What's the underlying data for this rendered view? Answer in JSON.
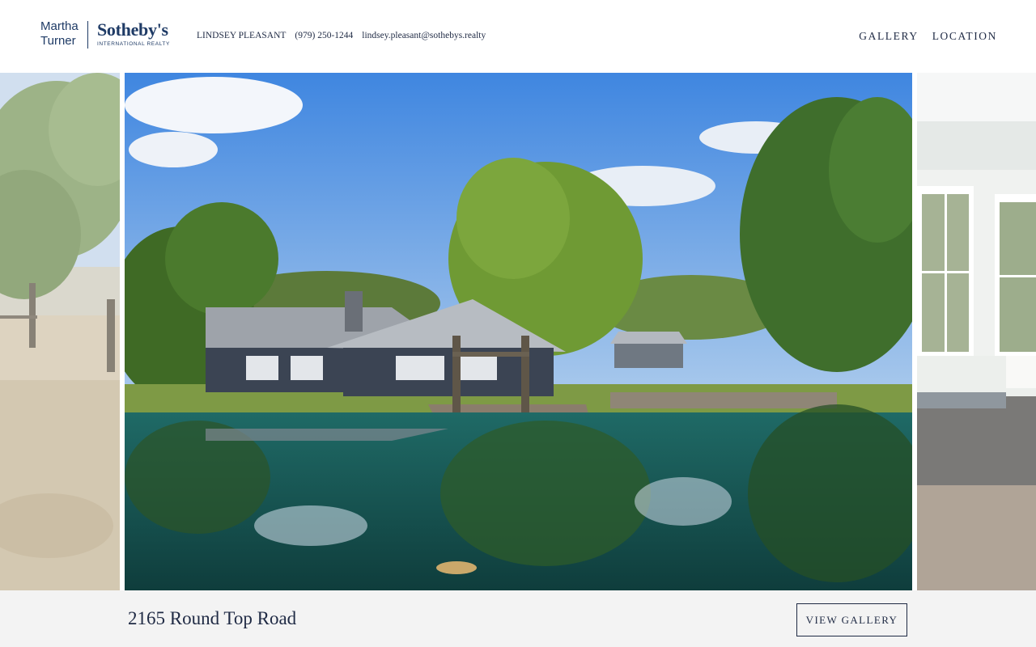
{
  "header": {
    "logo": {
      "line1": "Martha",
      "line2": "Turner",
      "brand": "Sotheby's",
      "subtitle": "INTERNATIONAL REALTY"
    },
    "contact": {
      "agent_name": "LINDSEY PLEASANT",
      "phone": "(979) 250-1244",
      "email": "lindsey.pleasant@sothebys.realty"
    },
    "nav": [
      "GALLERY",
      "LOCATION"
    ]
  },
  "carousel": {
    "main_image": "ranch-house-with-pond",
    "prev_image": "oak-trees-pasture",
    "next_image": "interior-living-room"
  },
  "footer": {
    "address": "2165 Round Top Road",
    "view_gallery_label": "VIEW GALLERY"
  },
  "colors": {
    "navy": "#1f2a44",
    "footer_bg": "#f3f3f3"
  }
}
